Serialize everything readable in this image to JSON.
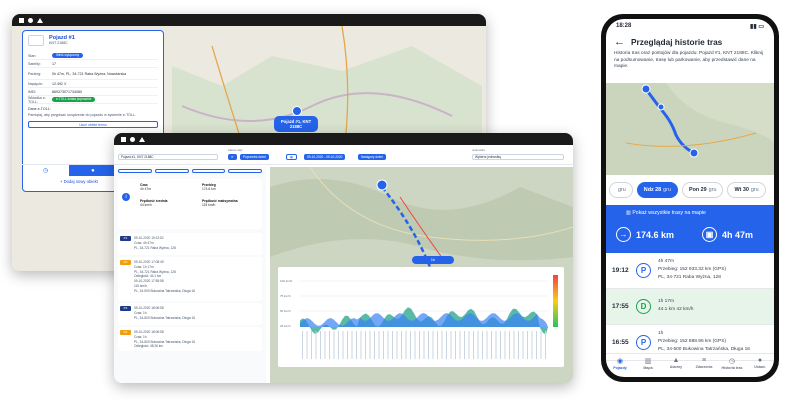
{
  "window1": {
    "vehicle_name": "Pojazd #1",
    "plate": "KNT 2188C",
    "rows": [
      {
        "key": "Stan:",
        "value": "Silnik wyłączony"
      },
      {
        "key": "Satelity:",
        "value": "17"
      },
      {
        "key": "Parking:",
        "value": "0h 47m, PL, 34-721 Raba Wyżna, Nowotarska"
      },
      {
        "key": "Napięcie:",
        "value": "12.492 V"
      },
      {
        "key": "IMEI:",
        "value": "869373071734080"
      },
      {
        "key": "Wkładka e-TOLL:",
        "value": "e-TOLL działa poprawnie"
      }
    ],
    "etoll_label": "Dane e-TOLL:",
    "etoll_note": "Pamiętaj, aby przypisać urządzenie do pojazdu w systemie e-TOLL.",
    "delete_button": "Usuń obiekt termo",
    "add_vehicle": "+ Dodaj nowy obiekt",
    "map_badge": "Pojazd #1, KNT 2188C"
  },
  "window2": {
    "vehicle_select": "Pojazd #1, KNT 2188C",
    "date_label": "Zakres daty",
    "prev_button": "Poprzedni dzień",
    "date_range": "09-10-2020 - 09-10-2020",
    "next_button": "Następny dzień",
    "unit_label": "Jednostka",
    "unit_select": "Wybierz jednostkę",
    "summary": {
      "time_label": "Czas",
      "time_value": "4h 47m",
      "distance_label": "Przebieg",
      "distance_value": "174.6 km",
      "avg_label": "Prędkość średnia",
      "avg_value": "44 km/h",
      "max_label": "Prędkość maksymalna",
      "max_value": "115 km/h"
    },
    "sections": [
      {
        "name": "P1",
        "lines": [
          "09-10-2020 19:12:52",
          "Czas: 4h 47m",
          "PL, 34-721 Raba Wyżna, 128"
        ]
      },
      {
        "name": "P2",
        "lines": [
          "09-10-2020 17:08:49",
          "Czas: 1h 17m",
          "PL, 34-721 Raba Wyżna, 128",
          "Odległość: 44.1 km",
          "09-10-2020 17:55:58",
          "115 km/h",
          "PL, 34-500 Bukowina Tatrzańska, Długa 16"
        ]
      },
      {
        "name": "P3",
        "lines": [
          "09-10-2020 18:06:58",
          "Czas: 1h",
          "PL, 34-500 Bukowina Tatrzańska, Długa 16"
        ]
      },
      {
        "name": "P4",
        "lines": [
          "09-10-2020 18:06:58",
          "Czas: 1h",
          "PL, 34-500 Bukowina Tatrzańska, Długa 16",
          "Odległość: 48.26 km"
        ]
      }
    ],
    "route_label": "1h",
    "chart_ylabels": [
      "100 km/h",
      "75 km/h",
      "50 km/h",
      "25 km/h"
    ]
  },
  "phone": {
    "time": "18:28",
    "title": "Przeglądaj historie tras",
    "description": "Historia tras oraz postojów dla pojazdu: Pojazd #1, KNT 2188C. Kliknij na podsumowanie, trasę lub parkowanie, aby przedstawić dane na mapie.",
    "days": [
      {
        "name": "",
        "date": "gru"
      },
      {
        "name": "Ndz 28",
        "date": "gru"
      },
      {
        "name": "Pon 29",
        "date": "gru"
      },
      {
        "name": "Wt 30",
        "date": "gru"
      }
    ],
    "show_all": "Pokaż wszystkie trasy na mapie",
    "distance": "174.6 km",
    "duration": "4h 47m",
    "timeline": [
      {
        "time": "19:12",
        "type": "P",
        "l1": "4h 47m",
        "l2": "Przebieg: 152 933.32 km (GPS)",
        "l3": "PL, 34-721 Raba Wyżna, 128"
      },
      {
        "time": "17:55",
        "type": "D",
        "l1": "1h 17m",
        "l2": "44.1 km   42 km/h",
        "l3": ""
      },
      {
        "time": "16:55",
        "type": "P",
        "l1": "1h",
        "l2": "Przebieg: 152 888.95 km (GPS)",
        "l3": "PL, 34-500 Bukowina Tatrzańska, Długa 16"
      }
    ],
    "nav": [
      "Pojazdy",
      "Mapa",
      "Alarmy",
      "Zdarzenia",
      "Historia tras",
      "Ustaw."
    ]
  }
}
